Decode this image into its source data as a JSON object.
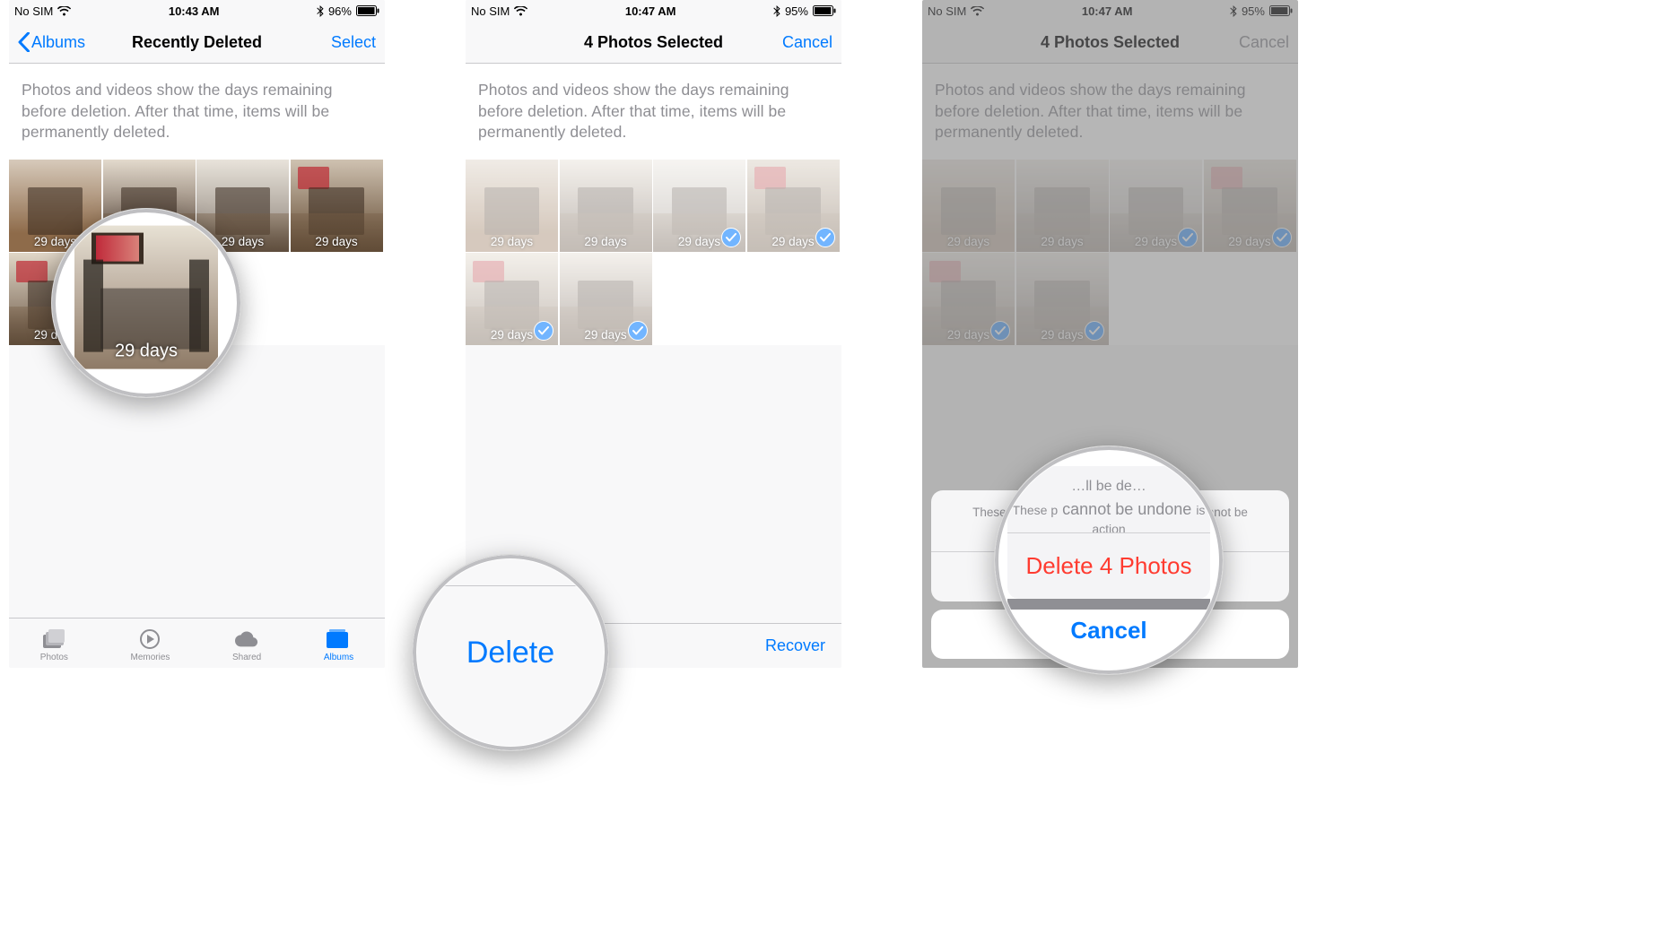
{
  "status": {
    "sim": "No SIM",
    "time1": "10:43 AM",
    "time2": "10:47 AM",
    "time3": "10:47 AM",
    "battery1": "96%",
    "battery2": "95%",
    "battery3": "95%"
  },
  "screen1": {
    "back_label": "Albums",
    "title": "Recently Deleted",
    "select_label": "Select",
    "description": "Photos and videos show the days remaining before deletion. After that time, items will be permanently deleted.",
    "thumbs": [
      {
        "days": "29 days"
      },
      {
        "days": "29 days"
      },
      {
        "days": "29 days"
      },
      {
        "days": "29 days"
      },
      {
        "days": "29 days"
      },
      {
        "days": "29 days"
      }
    ],
    "tabs": {
      "photos": "Photos",
      "memories": "Memories",
      "shared": "Shared",
      "albums": "Albums"
    },
    "zoom_label": "29 days"
  },
  "screen2": {
    "title": "4 Photos Selected",
    "cancel_label": "Cancel",
    "description": "Photos and videos show the days remaining before deletion. After that time, items will be permanently deleted.",
    "thumbs": [
      {
        "days": "29 days",
        "selected": false
      },
      {
        "days": "29 days",
        "selected": false
      },
      {
        "days": "29 days",
        "selected": true
      },
      {
        "days": "29 days",
        "selected": true
      },
      {
        "days": "29 days",
        "selected": true
      },
      {
        "days": "29 days",
        "selected": true
      }
    ],
    "toolbar_delete": "Delete",
    "toolbar_recover": "Recover",
    "zoom_delete": "Delete"
  },
  "screen3": {
    "title": "4 Photos Selected",
    "cancel_label": "Cancel",
    "description": "Photos and videos show the days remaining before deletion. After that time, items will be permanently deleted.",
    "thumbs": [
      {
        "days": "29 days",
        "selected": false
      },
      {
        "days": "29 days",
        "selected": false
      },
      {
        "days": "29 days",
        "selected": true
      },
      {
        "days": "29 days",
        "selected": true
      },
      {
        "days": "29 days",
        "selected": true
      },
      {
        "days": "29 days",
        "selected": true
      }
    ],
    "sheet": {
      "message": "These photos will be deleted. This action cannot be undone.",
      "delete_action": "Delete 4 Photos",
      "cancel": "Cancel"
    },
    "zoom": {
      "line1": "…ll be de…",
      "line2": "cannot be undone",
      "line2_left": "These p",
      "line2_right": "is action",
      "delete": "Delete 4 Photos",
      "cancel": "Cancel"
    }
  }
}
